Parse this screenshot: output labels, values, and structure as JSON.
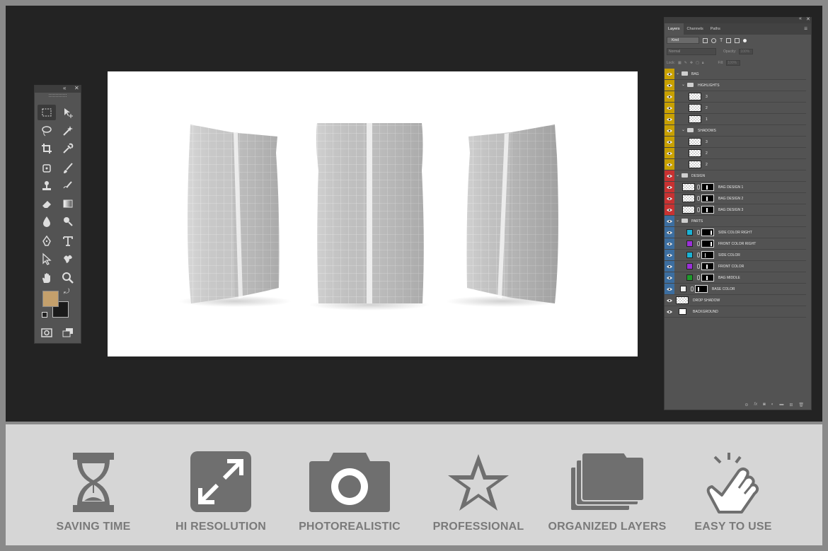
{
  "layers_panel": {
    "tabs": [
      "Layers",
      "Channels",
      "Paths"
    ],
    "filter_kind": "Kind",
    "blend_mode": "Normal",
    "opacity_label": "Opacity:",
    "opacity_value": "100%",
    "lock_label": "Lock:",
    "fill_label": "Fill:",
    "fill_value": "100%",
    "layers": [
      {
        "name": "BAG"
      },
      {
        "name": "HIGHLIGHTS"
      },
      {
        "name": "3"
      },
      {
        "name": "2"
      },
      {
        "name": "1"
      },
      {
        "name": "SHADOWS"
      },
      {
        "name": "3"
      },
      {
        "name": "2"
      },
      {
        "name": "2"
      },
      {
        "name": "DESIGN"
      },
      {
        "name": "BAG DESIGN 1"
      },
      {
        "name": "BAG DESIGN 2"
      },
      {
        "name": "BAG DESIGN 3"
      },
      {
        "name": "PARTS"
      },
      {
        "name": "SIDE COLOR RIGHT",
        "swatch": "#1ab3d6"
      },
      {
        "name": "FRONT COLOR RIGHT",
        "swatch": "#9b30d9"
      },
      {
        "name": "SIDE COLOR",
        "swatch": "#1ab3d6"
      },
      {
        "name": "FRONT COLOR",
        "swatch": "#9b30d9"
      },
      {
        "name": "BAG MIDDLE",
        "swatch": "#1e9a2c"
      },
      {
        "name": "BASE COLOR",
        "swatch": "#f0f0f0"
      },
      {
        "name": "DROP SHADOW"
      },
      {
        "name": "BACKGROUND"
      }
    ],
    "label_colors": {
      "yellow": "#c8a000",
      "red": "#c83232",
      "blue": "#3c6ea0"
    }
  },
  "tools_panel": {
    "foreground_color": "#c4a06c",
    "background_color": "#1a1a1a"
  },
  "features": [
    {
      "label": "SAVING TIME",
      "icon": "hourglass-icon"
    },
    {
      "label": "HI RESOLUTION",
      "icon": "expand-arrows-icon"
    },
    {
      "label": "PHOTOREALISTIC",
      "icon": "camera-icon"
    },
    {
      "label": "PROFESSIONAL",
      "icon": "star-icon"
    },
    {
      "label": "ORGANIZED LAYERS",
      "icon": "stacked-folders-icon"
    },
    {
      "label": "EASY TO USE",
      "icon": "tap-hand-icon"
    }
  ]
}
